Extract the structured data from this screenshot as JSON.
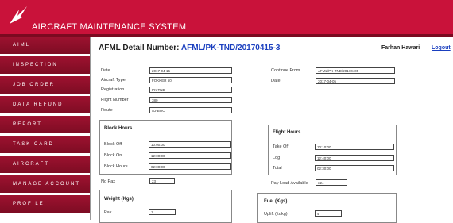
{
  "app": {
    "title": "AIRCRAFT MAINTENANCE SYSTEM"
  },
  "colors": {
    "brand": "#c9123a",
    "nav": "#8f0f2a",
    "link": "#1a3fbf"
  },
  "nav": [
    "AIML",
    "INSPECTION",
    "JOB ORDER",
    "DATA REFUND",
    "REPORT",
    "TASK CARD",
    "AIRCRAFT",
    "MANAGE ACCOUNT",
    "PROFILE"
  ],
  "page": {
    "title_prefix": "AFML Detail Number:",
    "title_number": "AFML/PK-TND/20170415-3"
  },
  "user": {
    "name": "Farhan Hawari",
    "logout": "Logout"
  },
  "form": {
    "date_label": "Date",
    "date": "2017-04-15",
    "aircraft_type_label": "Aircraft Type",
    "aircraft_type": "FOKKER 50",
    "registration_label": "Registration",
    "registration": "PK-TND",
    "flight_number_label": "Flight Number",
    "flight_number": "380",
    "route_label": "Route",
    "route": "AJ-BOC",
    "continue_from_label": "Continue From",
    "continue_from": "AFML/PK-TND/20170405",
    "date2_label": "Date",
    "date2": "2017-04-05"
  },
  "block_hours": {
    "title": "Block Hours",
    "block_off_label": "Block Off",
    "block_off": "10:00:00",
    "block_on_label": "Block On",
    "block_on": "12:00:00",
    "block_hours_label": "Block Hours",
    "block_hours": "02:00:00"
  },
  "flight_hours": {
    "title": "Flight Hours",
    "take_off_label": "Take Off",
    "take_off": "10:10:00",
    "log_label": "Log",
    "log": "12:40:00",
    "total_label": "Total",
    "total": "02:30:00"
  },
  "no_pax_label": "No Pax",
  "no_pax": "23",
  "pay_load_label": "Pay Load Available",
  "pay_load": "324",
  "weight": {
    "title": "Weight (Kgs)",
    "pax_label": "Pax",
    "pax": "1"
  },
  "fuel": {
    "title": "Fuel (Kgs)",
    "uplift_label": "Uplift (ltr/kg)",
    "uplift": "4"
  }
}
